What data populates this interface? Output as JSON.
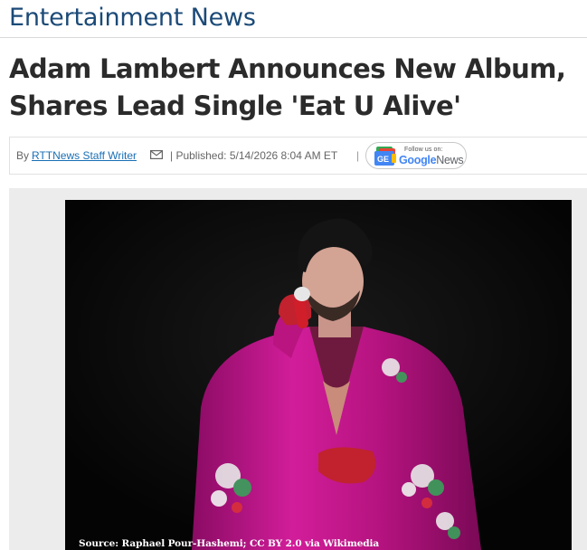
{
  "section": {
    "title": "Entertainment News"
  },
  "article": {
    "headline": "Adam Lambert Announces New Album, Shares Lead Single 'Eat U Alive'",
    "byline": {
      "prefix": "By",
      "author": "RTTNews Staff Writer",
      "published": "| Published: 5/14/2026 8:04 AM ET",
      "separator": "|"
    },
    "google_news": {
      "follow_text": "Follow us on:",
      "logo_letters": "GE",
      "word_google": "Google",
      "word_news": "News"
    },
    "image": {
      "caption": "Source: Raphael Pour-Hashemi; CC BY 2.0 via Wikimedia",
      "jacket_color": "#c0148c",
      "background_color": "#050505"
    }
  },
  "colors": {
    "section_title": "#1b4a78",
    "headline": "#2b2b2b",
    "link": "#1a6fb5",
    "google_blue": "#4285f4",
    "google_red": "#ea4335",
    "google_yellow": "#fbbc05",
    "google_green": "#34a853"
  },
  "icons": {
    "mail": "mail-icon",
    "google_news_logo": "google-news-logo-icon"
  }
}
